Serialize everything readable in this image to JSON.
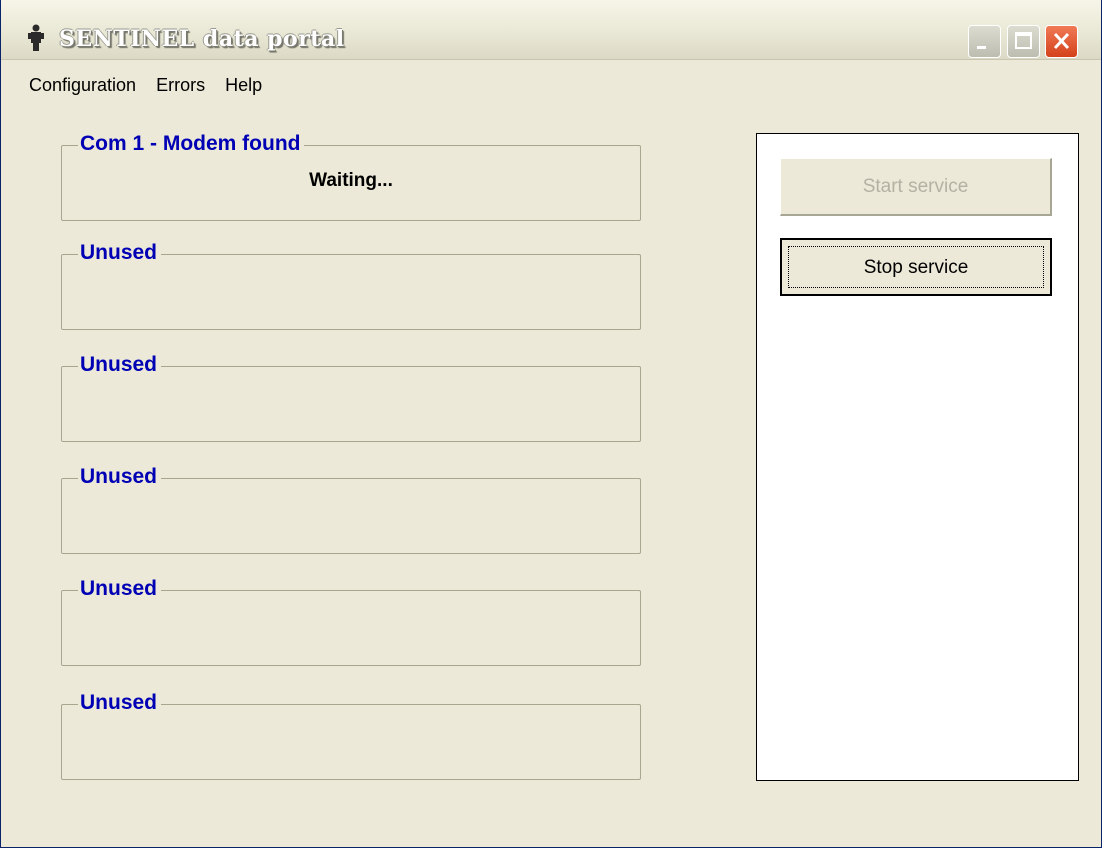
{
  "window": {
    "title": "SENTINEL data portal",
    "icon": "app-figure-icon",
    "controls": [
      "minimize-icon",
      "maximize-icon",
      "close-icon"
    ]
  },
  "menu": {
    "items": [
      {
        "label": "Configuration"
      },
      {
        "label": "Errors"
      },
      {
        "label": "Help"
      }
    ]
  },
  "ports": [
    {
      "label": "Com 1 - Modem found",
      "status": "Waiting..."
    },
    {
      "label": "Unused",
      "status": ""
    },
    {
      "label": "Unused",
      "status": ""
    },
    {
      "label": "Unused",
      "status": ""
    },
    {
      "label": "Unused",
      "status": ""
    },
    {
      "label": "Unused",
      "status": ""
    }
  ],
  "service": {
    "start_label": "Start service",
    "start_enabled": false,
    "stop_label": "Stop service",
    "stop_enabled": true
  },
  "colors": {
    "group_label": "#0000b4",
    "window_bg": "#ece9d8",
    "close_button": "#d4421c"
  }
}
